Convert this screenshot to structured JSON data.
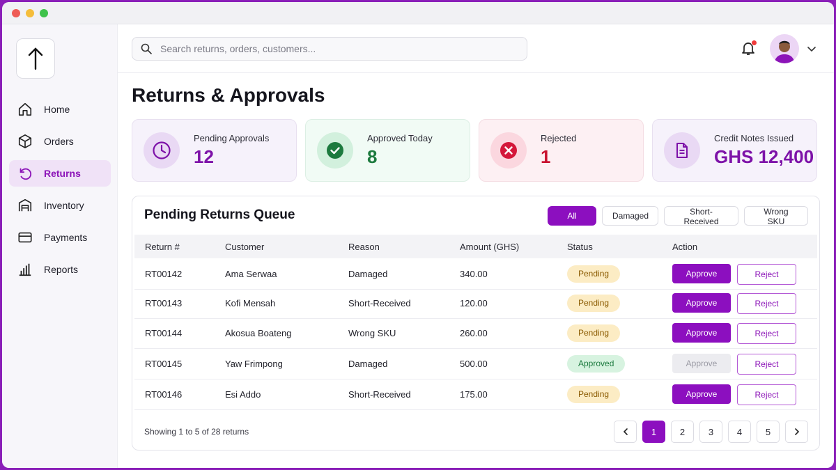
{
  "sidebar": {
    "items": [
      {
        "label": "Home",
        "icon": "home-icon"
      },
      {
        "label": "Orders",
        "icon": "box-icon"
      },
      {
        "label": "Returns",
        "icon": "return-icon",
        "active": true
      },
      {
        "label": "Inventory",
        "icon": "warehouse-icon"
      },
      {
        "label": "Payments",
        "icon": "card-icon"
      },
      {
        "label": "Reports",
        "icon": "bar-chart-icon"
      }
    ]
  },
  "search": {
    "placeholder": "Search returns, orders, customers..."
  },
  "page": {
    "title": "Returns & Approvals"
  },
  "stats": [
    {
      "label": "Pending Approvals",
      "value": "12",
      "icon": "clock-icon"
    },
    {
      "label": "Approved Today",
      "value": "8",
      "icon": "check-circle-icon"
    },
    {
      "label": "Rejected",
      "value": "1",
      "icon": "x-circle-icon"
    },
    {
      "label": "Credit Notes Issued",
      "value": "GHS 12,400",
      "icon": "document-icon"
    }
  ],
  "queue": {
    "title": "Pending Returns Queue",
    "filters": [
      "All",
      "Damaged",
      "Short-Received",
      "Wrong SKU"
    ],
    "active_filter": "All",
    "columns": [
      "Return #",
      "Customer",
      "Reason",
      "Amount (GHS)",
      "Status",
      "Action"
    ],
    "rows": [
      {
        "id": "RT00142",
        "customer": "Ama Serwaa",
        "reason": "Damaged",
        "amount": "340.00",
        "status": "Pending",
        "approve": "Approve",
        "reject": "Reject"
      },
      {
        "id": "RT00143",
        "customer": "Kofi Mensah",
        "reason": "Short-Received",
        "amount": "120.00",
        "status": "Pending",
        "approve": "Approve",
        "reject": "Reject"
      },
      {
        "id": "RT00144",
        "customer": "Akosua Boateng",
        "reason": "Wrong SKU",
        "amount": "260.00",
        "status": "Pending",
        "approve": "Approve",
        "reject": "Reject"
      },
      {
        "id": "RT00145",
        "customer": "Yaw Frimpong",
        "reason": "Damaged",
        "amount": "500.00",
        "status": "Approved",
        "approve": "Approve",
        "reject": "Reject"
      },
      {
        "id": "RT00146",
        "customer": "Esi Addo",
        "reason": "Short-Received",
        "amount": "175.00",
        "status": "Pending",
        "approve": "Approve",
        "reject": "Reject"
      }
    ],
    "footer": "Showing 1 to 5 of 28 returns",
    "pages": [
      "1",
      "2",
      "3",
      "4",
      "5"
    ],
    "current_page": "1"
  },
  "colors": {
    "accent": "#8c0fbf",
    "pending": "#fcecc4",
    "approved": "#d7f3e0",
    "rejected": "#c8102e"
  }
}
